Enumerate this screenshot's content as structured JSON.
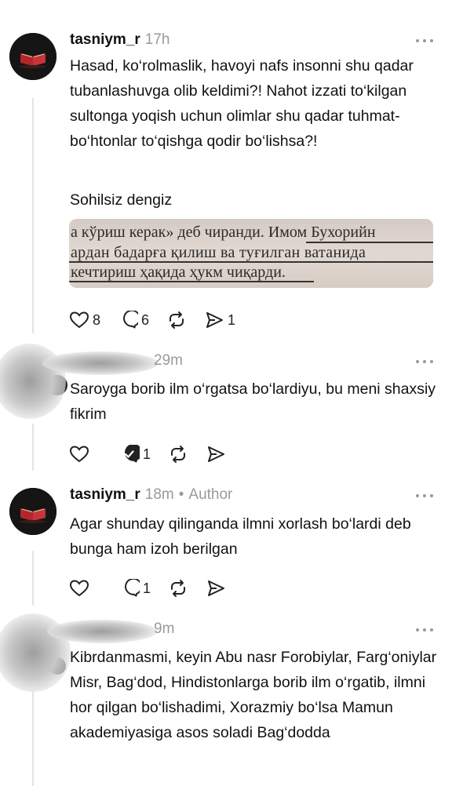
{
  "posts": [
    {
      "username": "tasniym_r",
      "time": "17h",
      "text": "Hasad, ko‘rolmaslik, havoyi nafs insonni shu qadar tubanlashuvga olib keldimi?! Nahot izzati to‘kilgan sultonga yoqish uchun olimlar shu qadar tuhmat-bo‘htonlar to‘qishga qodir bo‘lishsa?!",
      "caption": "Sohilsiz dengiz",
      "media_lines": [
        "а кўриш керак» деб чиранди. Имом Бухорийн",
        "ардан бадарға қилиш ва туғилган ватанида",
        "кечтириш ҳақида ҳукм чиқарди."
      ],
      "likes": "8",
      "replies": "6",
      "shares": "1"
    },
    {
      "time": "29m",
      "text": "Saroyga borib ilm o‘rgatsa bo‘lardiyu, bu meni shaxsiy fikrim",
      "replies": "1"
    },
    {
      "username": "tasniym_r",
      "time": "18m",
      "author_label": "Author",
      "text": "Agar shunday qilinganda ilmni xorlash bo‘lardi deb bunga ham izoh berilgan",
      "replies": "1"
    },
    {
      "time": "9m",
      "text": "Kibrdanmasmi,  keyin Abu nasr Forobiylar, Farg‘oniylar Misr, Bag‘dod, Hindistonlarga borib ilm o‘rgatib, ilmni hor qilgan bo‘lishadimi, Xorazmiy bo‘lsa Mamun akademiyasiga asos soladi Bag‘dodda"
    }
  ]
}
